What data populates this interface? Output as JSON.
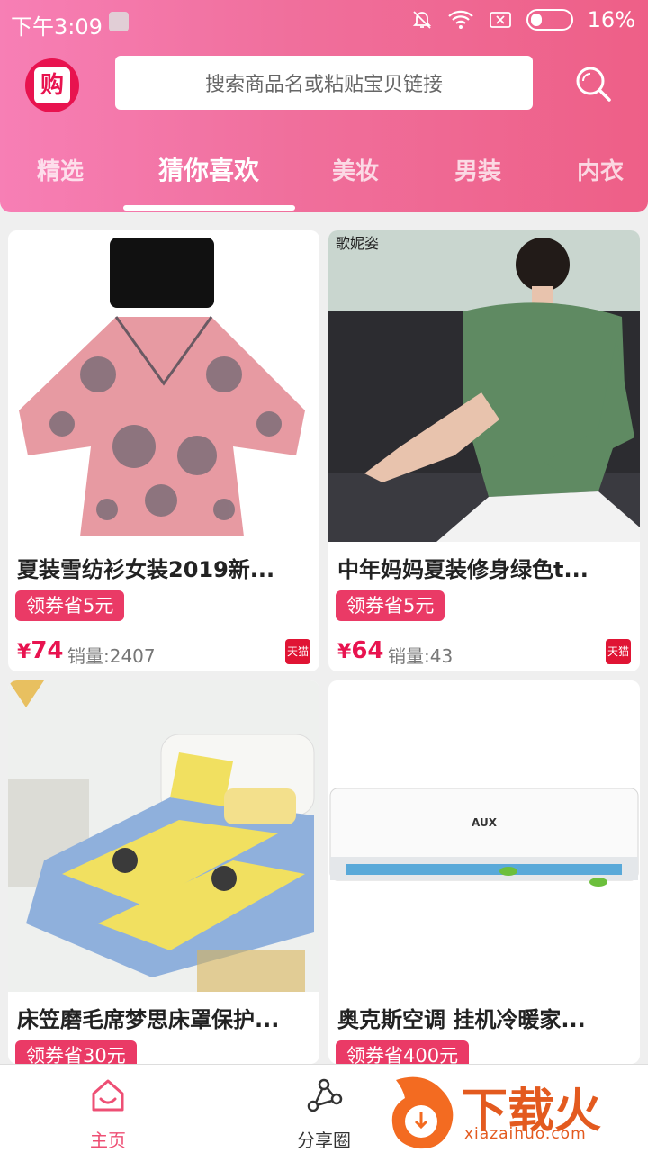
{
  "status_bar": {
    "time": "下午3:09",
    "battery": "16%"
  },
  "search": {
    "placeholder": "搜索商品名或粘贴宝贝链接"
  },
  "logo": {
    "glyph": "购"
  },
  "tabs": [
    {
      "label": "精选"
    },
    {
      "label": "猜你喜欢"
    },
    {
      "label": "美妆"
    },
    {
      "label": "男装"
    },
    {
      "label": "内衣"
    }
  ],
  "products": [
    {
      "title": "夏装雪纺衫女装2019新...",
      "coupon": "领券省5元",
      "price_symbol": "¥",
      "price": "74",
      "sales": "销量:2407",
      "badge": "天猫"
    },
    {
      "title": "中年妈妈夏装修身绿色t...",
      "coupon": "领券省5元",
      "price_symbol": "¥",
      "price": "64",
      "sales": "销量:43",
      "badge": "天猫"
    },
    {
      "title": "床笠磨毛席梦思床罩保护...",
      "coupon": "领券省30元"
    },
    {
      "title": "奥克斯空调 挂机冷暖家...",
      "coupon": "领券省400元"
    }
  ],
  "product_images": [
    {
      "caption": ""
    },
    {
      "caption": "歌妮姿"
    },
    {
      "caption": ""
    },
    {
      "caption": "AUX"
    }
  ],
  "bottom_nav": [
    {
      "label": "主页",
      "icon": "home-icon"
    },
    {
      "label": "分享圈",
      "icon": "share-icon"
    }
  ],
  "watermark": {
    "text": "下载火",
    "url": "xiazaihuo.com"
  },
  "colors": {
    "brand_pink": "#ee5f87",
    "coupon_red": "#ea3a66",
    "price_red": "#e8134f"
  }
}
